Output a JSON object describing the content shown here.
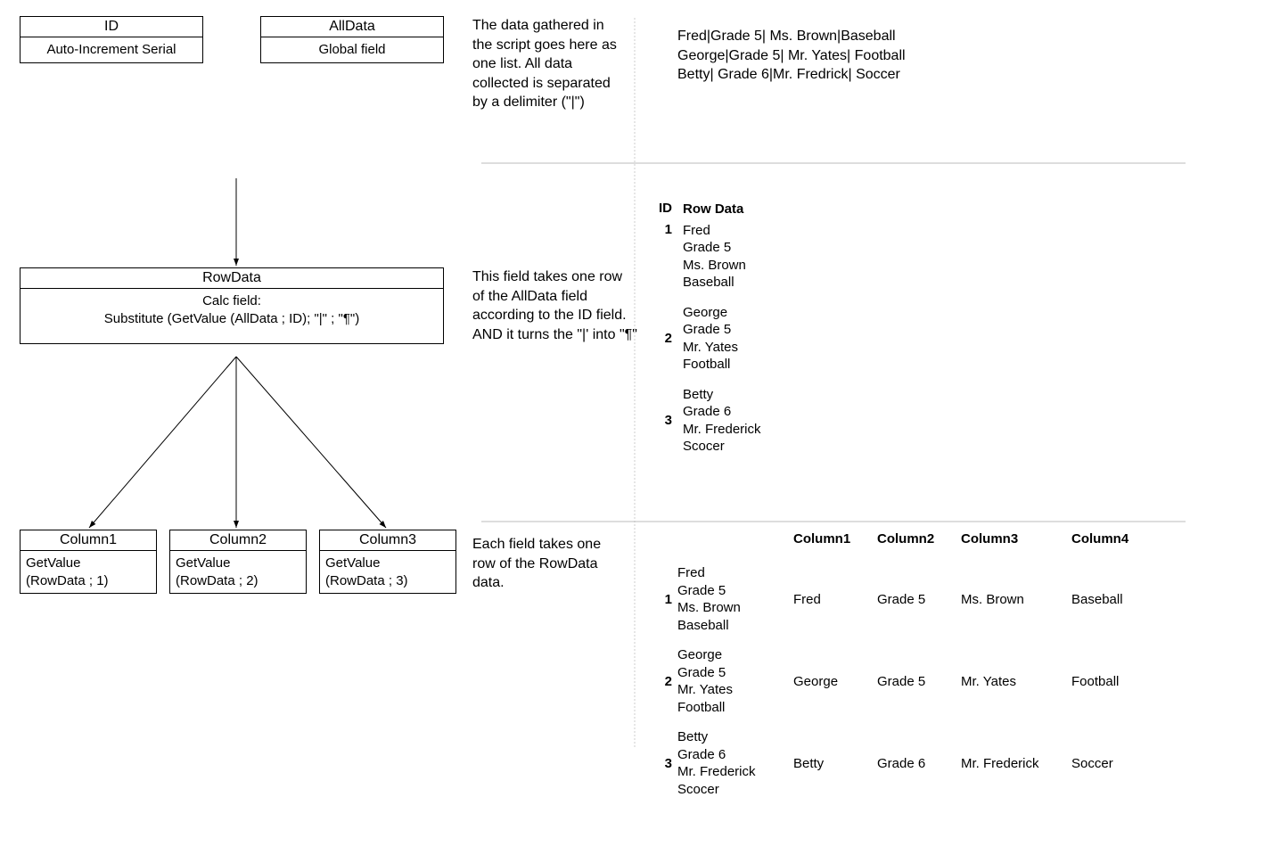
{
  "boxes": {
    "id": {
      "title": "ID",
      "body": "Auto-Increment Serial"
    },
    "alldata": {
      "title": "AllData",
      "body": "Global field"
    },
    "rowdata": {
      "title": "RowData",
      "body_line1": "Calc field:",
      "body_line2": "Substitute (GetValue (AllData ; ID); \"|\" ; \"¶\")"
    },
    "col1": {
      "title": "Column1",
      "body_line1": "GetValue",
      "body_line2": "(RowData ; 1)"
    },
    "col2": {
      "title": "Column2",
      "body_line1": "GetValue",
      "body_line2": "(RowData ; 2)"
    },
    "col3": {
      "title": "Column3",
      "body_line1": "GetValue",
      "body_line2": "(RowData ; 3)"
    }
  },
  "paragraphs": {
    "p1": "The data gathered in the script goes here as one list. All data collected is separated by a delimiter (\"|\")",
    "p2": "This field takes one row of the AllData field according to the ID field.\nAND it turns the \"|' into \"¶\"",
    "p3": "Each field takes one row of the RowData data."
  },
  "samples": {
    "alldata_lines": [
      "Fred|Grade 5| Ms. Brown|Baseball",
      "George|Grade 5| Mr. Yates| Football",
      "Betty| Grade 6|Mr. Fredrick| Soccer"
    ]
  },
  "rowdata_table": {
    "id_header": "ID",
    "row_header": "Row Data",
    "rows": [
      {
        "id": "1",
        "lines": [
          "Fred",
          "Grade 5",
          "Ms. Brown",
          "Baseball"
        ]
      },
      {
        "id": "2",
        "lines": [
          "George",
          "Grade 5",
          "Mr. Yates",
          "Football"
        ]
      },
      {
        "id": "3",
        "lines": [
          "Betty",
          "Grade 6",
          "Mr. Frederick",
          "Scocer"
        ]
      }
    ]
  },
  "final_table": {
    "headers": {
      "c1": "Column1",
      "c2": "Column2",
      "c3": "Column3",
      "c4": "Column4"
    },
    "rows": [
      {
        "id": "1",
        "rowdata": [
          "Fred",
          "Grade 5",
          "Ms. Brown",
          "Baseball"
        ],
        "c1": "Fred",
        "c2": "Grade 5",
        "c3": "Ms. Brown",
        "c4": "Baseball"
      },
      {
        "id": "2",
        "rowdata": [
          "George",
          "Grade 5",
          "Mr. Yates",
          "Football"
        ],
        "c1": "George",
        "c2": "Grade 5",
        "c3": "Mr. Yates",
        "c4": "Football"
      },
      {
        "id": "3",
        "rowdata": [
          "Betty",
          "Grade 6",
          "Mr. Frederick",
          "Scocer"
        ],
        "c1": "Betty",
        "c2": "Grade 6",
        "c3": "Mr. Frederick",
        "c4": "Soccer"
      }
    ]
  }
}
